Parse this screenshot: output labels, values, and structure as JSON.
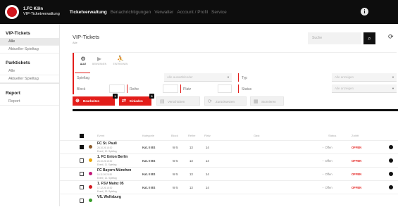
{
  "header": {
    "brand_line1": "1.FC Köln",
    "brand_line2": "VIP-Ticketverwaltung",
    "nav": [
      "Ticketverwaltung",
      "Benachrichtigungen",
      "Verwalter",
      "Account / Profil",
      "Service"
    ],
    "info_icon": "i"
  },
  "sidebar": {
    "sections": [
      {
        "title": "VIP-Tickets",
        "items": [
          "Alle",
          "Aktueller Spieltag"
        ]
      },
      {
        "title": "Parktickets",
        "items": [
          "Alle",
          "Aktueller Spieltag"
        ]
      },
      {
        "title": "Report",
        "items": [
          "Report"
        ]
      }
    ]
  },
  "main": {
    "title": "VIP-Tickets",
    "subtitle": "Alle",
    "search_placeholder": "Suche",
    "tabs": [
      {
        "label": "ALLE",
        "icon": "⚙"
      },
      {
        "label": "BENNENNEN",
        "icon": "▶"
      },
      {
        "label": "EINTRENNEN",
        "icon": "⛹"
      }
    ],
    "filters": {
      "spieltag_label": "Spieltag",
      "spieltag_placeholder": "Alle auswählender",
      "typ_label": "Typ",
      "typ_placeholder": "Alle anzeigen",
      "block_label": "Block",
      "reihe_label": "Reihe",
      "platz_label": "Platz",
      "status_label": "Status",
      "status_placeholder": "Alle anzeigen"
    },
    "buttons": [
      {
        "label": "Bearbeiten",
        "icon": "⊕",
        "badge": "1"
      },
      {
        "label": "Einladen",
        "icon": "⇄",
        "badge": "3"
      },
      {
        "label": "Verschicken",
        "icon": "▤"
      },
      {
        "label": "Zurücksetzen",
        "icon": "⟳"
      },
      {
        "label": "Stornieren",
        "icon": "▦"
      }
    ],
    "columns": [
      "Event",
      "Kategorie",
      "Block",
      "Reihe",
      "Platz",
      "Gast",
      "Status",
      "Zutritt"
    ],
    "rows": [
      {
        "team": "FC St. Pauli",
        "date": "28.10.26 15:30",
        "sub": "Event | 10. Spieltag",
        "cat": "Kat. II BS",
        "block": "W 5",
        "reihe": "13",
        "platz": "14",
        "status": "Offen",
        "entry": "OFFEN",
        "checked": true,
        "color": "#8b5a2b"
      },
      {
        "team": "1. FC Union Berlin",
        "date": "26.10.26 15:30",
        "sub": "Event | 11. Spieltag",
        "cat": "Kat. II BS",
        "block": "W 5",
        "reihe": "13",
        "platz": "14",
        "status": "Offen",
        "entry": "OFFEN",
        "checked": false,
        "color": "#e8a70c"
      },
      {
        "team": "FC Bayern München",
        "date": "14.11.26 20:30",
        "sub": "Event | 12. Spieltag",
        "cat": "Kat. II BS",
        "block": "W 5",
        "reihe": "13",
        "platz": "14",
        "status": "Offen",
        "entry": "OFFEN",
        "checked": false,
        "color": "#c21a7a"
      },
      {
        "team": "1. FSV Mainz 05",
        "date": "17.12.26 15:30",
        "sub": "Event | 13. Spieltag",
        "cat": "Kat. II BS",
        "block": "W 5",
        "reihe": "13",
        "platz": "14",
        "status": "Offen",
        "entry": "OFFEN",
        "checked": false,
        "color": "#d2171e"
      },
      {
        "team": "VfL Wolfsburg",
        "date": "",
        "sub": "",
        "cat": "",
        "block": "",
        "reihe": "",
        "platz": "",
        "status": "",
        "entry": "",
        "checked": false,
        "color": "#3a9d2c"
      }
    ]
  }
}
